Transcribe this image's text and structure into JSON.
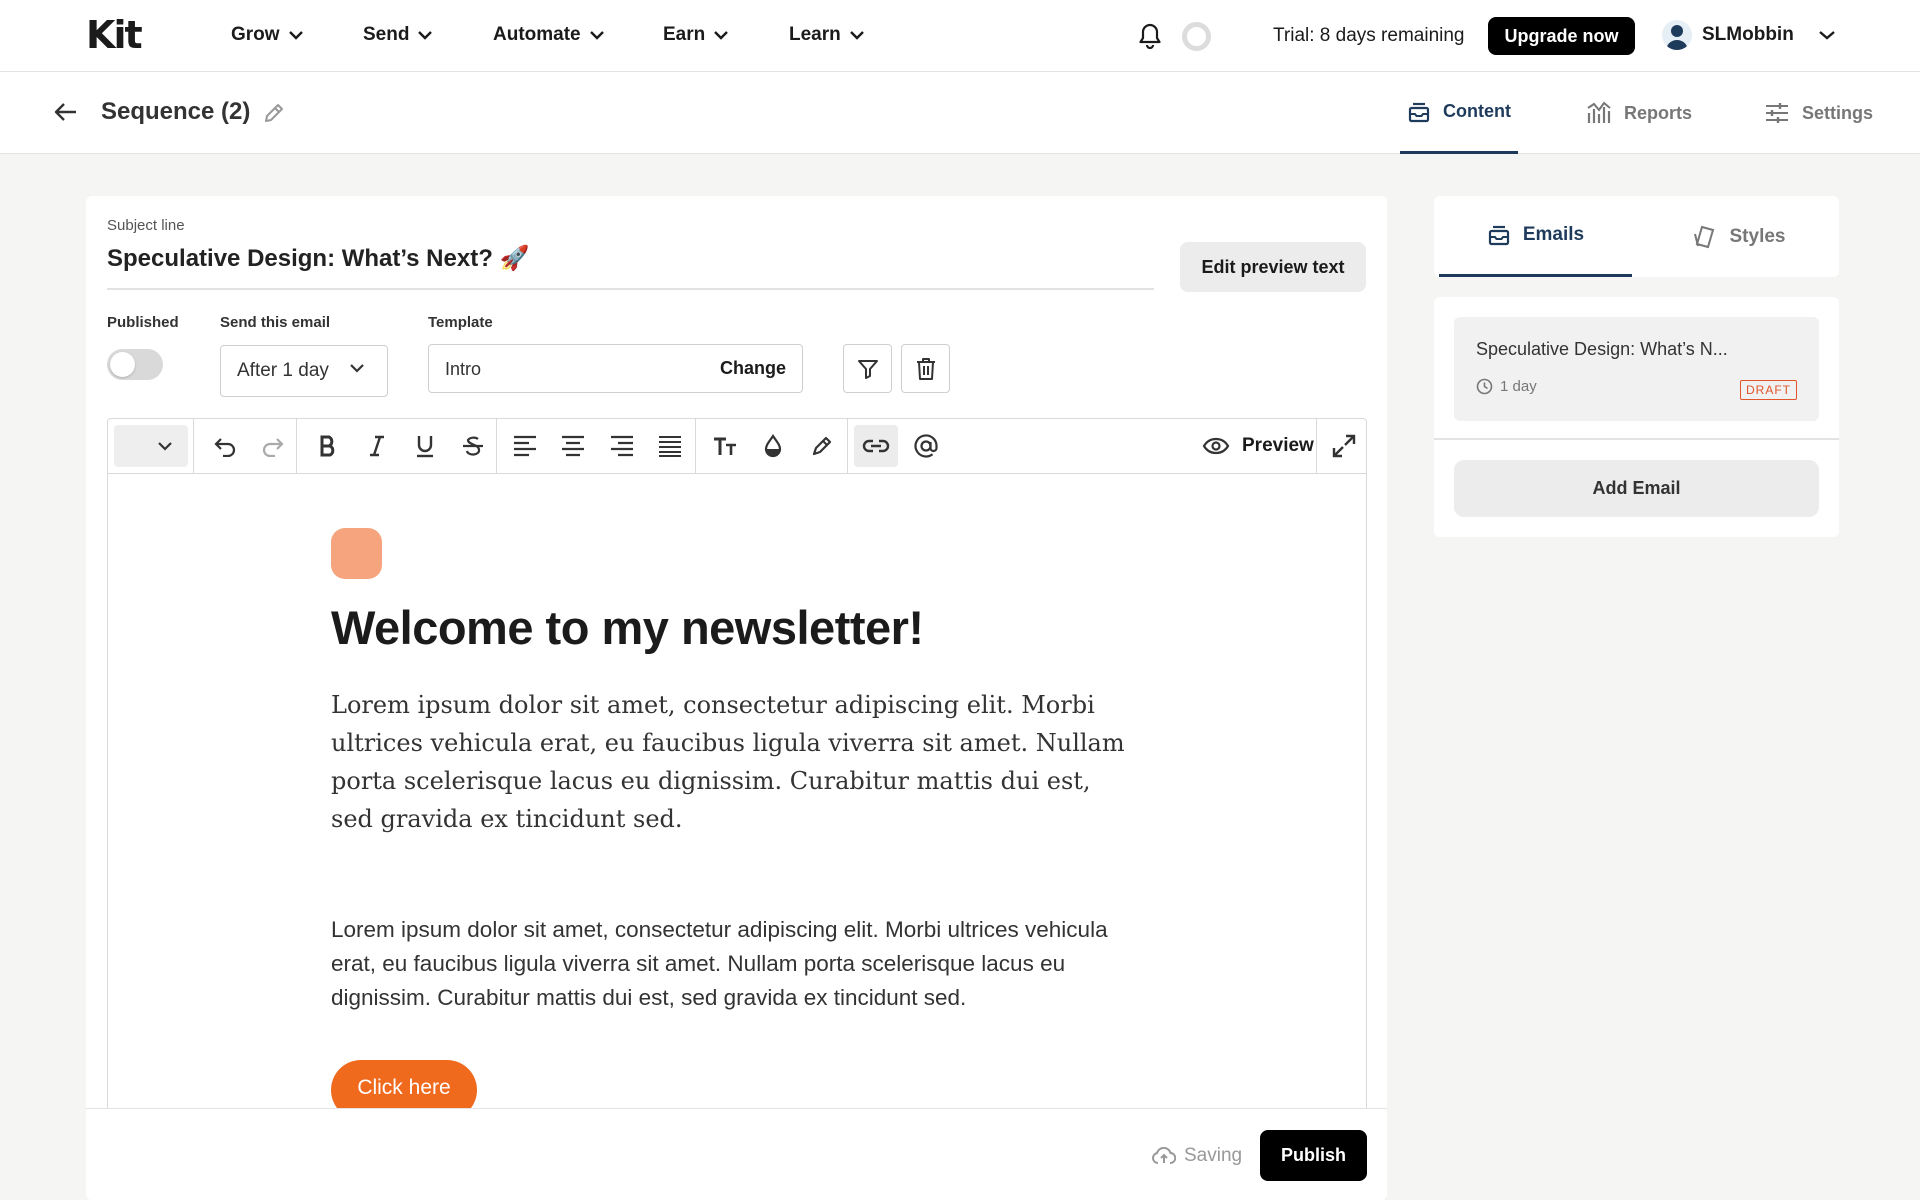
{
  "topnav": {
    "logo": "Kit",
    "items": [
      {
        "label": "Grow"
      },
      {
        "label": "Send"
      },
      {
        "label": "Automate"
      },
      {
        "label": "Earn"
      },
      {
        "label": "Learn"
      }
    ],
    "trial_text": "Trial: 8 days remaining",
    "upgrade_label": "Upgrade now",
    "username": "SLMobbin"
  },
  "subheader": {
    "title": "Sequence (2)",
    "tabs": [
      {
        "label": "Content",
        "active": true,
        "icon": "inbox-icon"
      },
      {
        "label": "Reports",
        "active": false,
        "icon": "bar-chart-icon"
      },
      {
        "label": "Settings",
        "active": false,
        "icon": "sliders-icon"
      }
    ]
  },
  "editor": {
    "subject_label": "Subject line",
    "subject_value": "Speculative Design: What’s Next? 🚀",
    "edit_preview_label": "Edit preview text",
    "published_label": "Published",
    "published_on": false,
    "send_label": "Send this email",
    "send_value": "After 1 day",
    "template_label": "Template",
    "template_value": "Intro",
    "template_change": "Change",
    "preview_label": "Preview"
  },
  "email": {
    "headline": "Welcome to my newsletter!",
    "para1": "Lorem ipsum dolor sit amet, consectetur adipiscing elit. Morbi ultrices vehicula erat, eu faucibus ligula viverra sit amet. Nullam porta scelerisque lacus eu dignissim. Curabitur mattis dui est, sed gravida ex tincidunt sed.",
    "para2": "Lorem ipsum dolor sit amet, consectetur adipiscing elit. Morbi ultrices vehicula erat, eu faucibus ligula viverra sit amet. Nullam porta scelerisque lacus eu dignissim. Curabitur mattis dui est, sed gravida ex tincidunt sed.",
    "button_label": "Click here",
    "accent_color": "#f06a1e",
    "logo_color": "#f6a47d"
  },
  "footer": {
    "saving_label": "Saving",
    "publish_label": "Publish"
  },
  "sidebar": {
    "tabs": [
      {
        "label": "Emails",
        "active": true
      },
      {
        "label": "Styles",
        "active": false
      }
    ],
    "email_item": {
      "title": "Speculative Design: What’s N...",
      "delay": "1 day",
      "badge": "DRAFT"
    },
    "add_email_label": "Add Email"
  },
  "colors": {
    "active_tab": "#1f3b5c",
    "draft_badge": "#e0552a",
    "upgrade_bg": "#000000"
  }
}
